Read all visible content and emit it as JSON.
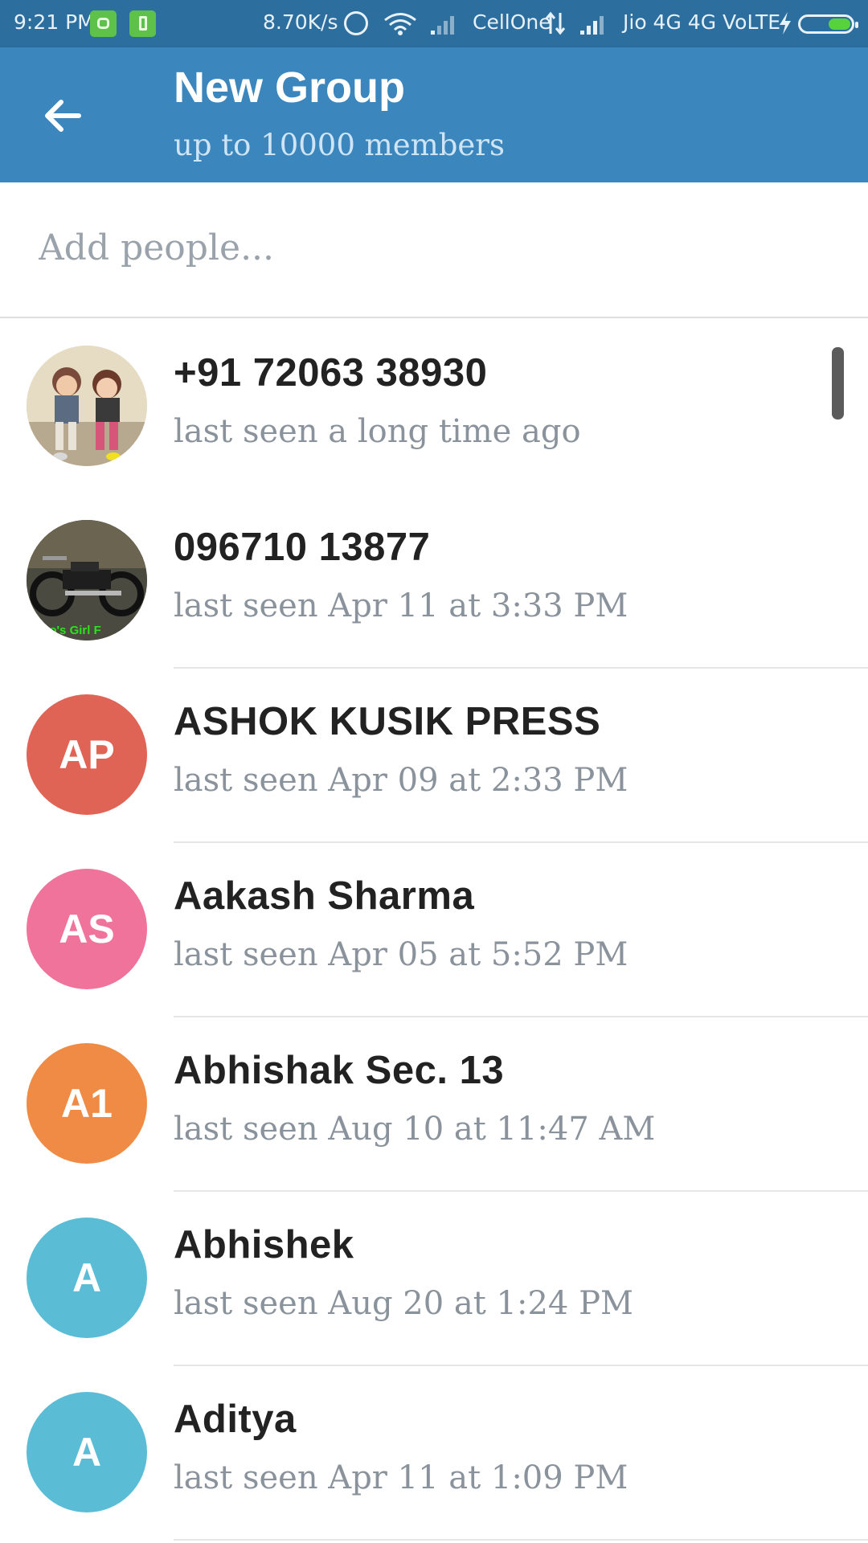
{
  "status_bar": {
    "time": "9:21 PM",
    "speed": "8.70K/s",
    "carrier1": "CellOne",
    "carrier2": "Jio 4G 4G VoLTE",
    "icons": [
      "android-icon",
      "battery-saver-icon",
      "alarm-icon",
      "wifi-icon",
      "signal-icon",
      "data-arrows-icon",
      "signal-icon",
      "charging-bolt-icon",
      "battery-icon"
    ],
    "battery_level": 0.4
  },
  "app_bar": {
    "title": "New Group",
    "subtitle": "up to 10000 members",
    "background": "#3a86bd"
  },
  "search": {
    "placeholder": "Add people..."
  },
  "contacts": [
    {
      "name": "+91 72063 38930",
      "status": "last seen a long time ago",
      "avatar_type": "photo-children"
    },
    {
      "name": "096710 13877",
      "status": "last seen Apr 11 at 3:33 PM",
      "avatar_type": "photo-motorcycle",
      "avatar_caption": "ono's Girl F"
    },
    {
      "name": "ASHOK KUSIK PRESS",
      "status": "last seen Apr 09 at 2:33 PM",
      "initials": "AP",
      "color": "#e06455"
    },
    {
      "name": "Aakash Sharma",
      "status": "last seen Apr 05 at 5:52 PM",
      "initials": "AS",
      "color": "#f0739c"
    },
    {
      "name": "Abhishak Sec. 13",
      "status": "last seen Aug 10 at 11:47 AM",
      "initials": "A1",
      "color": "#f08b46"
    },
    {
      "name": "Abhishek",
      "status": "last seen Aug 20 at 1:24 PM",
      "initials": "A",
      "color": "#5bbcd6"
    },
    {
      "name": "Aditya",
      "status": "last seen Apr 11 at 1:09 PM",
      "initials": "A",
      "color": "#5bbcd6"
    }
  ]
}
